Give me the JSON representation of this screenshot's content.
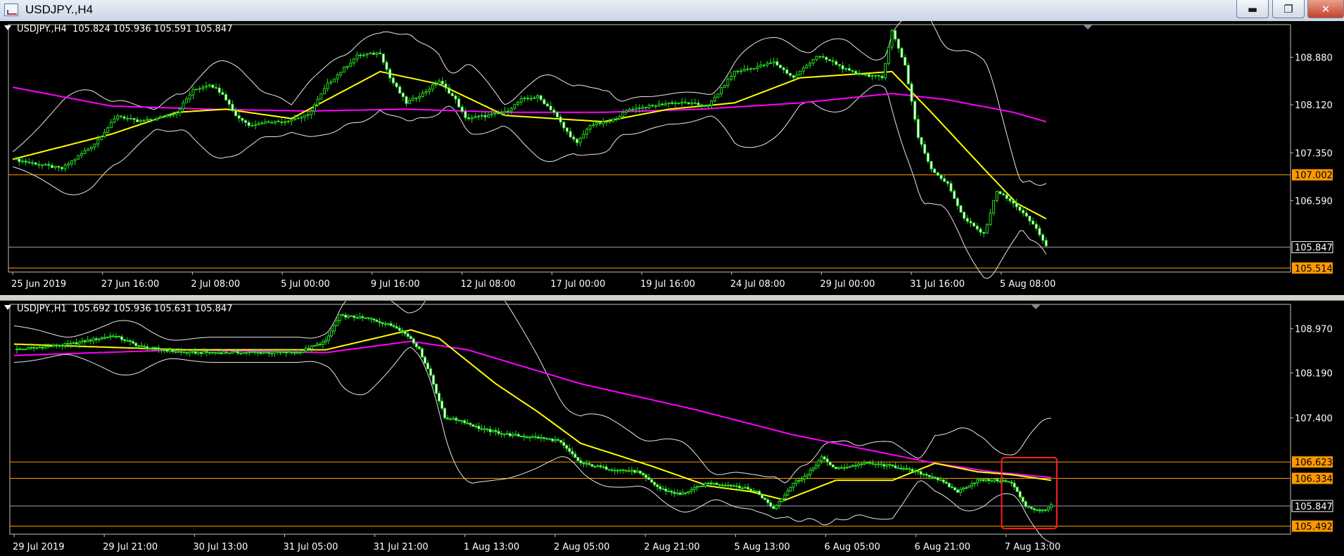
{
  "window": {
    "title": "USDJPY.,H4",
    "buttons": {
      "minimize": "▬",
      "restore": "❐",
      "close": "✕"
    }
  },
  "colors": {
    "candle": "#22dd22",
    "candle_bull_body": "#000000",
    "candle_bear_body": "#ffffff",
    "bollinger": "#e8e8e8",
    "ma_fast": "#ffff00",
    "ma_slow": "#ff00ff",
    "hline": "#ff9900",
    "current_price_line": "#9aa4b0",
    "red_box": "#ff2020"
  },
  "chart_data": [
    {
      "type": "candlestick",
      "symbol": "USDJPY.",
      "timeframe": "H4",
      "header": "USDJPY.,H4  105.824 105.936 105.591 105.847",
      "ylim": [
        105.45,
        109.4
      ],
      "y_ticks": [
        108.88,
        108.12,
        107.35,
        106.59
      ],
      "y_tick_labels": [
        "108.880",
        "108.120",
        "107.350",
        "106.590"
      ],
      "x_labels": [
        "25 Jun 2019",
        "27 Jun 16:00",
        "2 Jul 08:00",
        "5 Jul 00:00",
        "9 Jul 16:00",
        "12 Jul 08:00",
        "17 Jul 00:00",
        "19 Jul 16:00",
        "24 Jul 08:00",
        "29 Jul 00:00",
        "31 Jul 16:00",
        "5 Aug 08:00"
      ],
      "price_path": [
        [
          0,
          107.25
        ],
        [
          15,
          107.1
        ],
        [
          25,
          107.5
        ],
        [
          32,
          107.95
        ],
        [
          38,
          107.85
        ],
        [
          44,
          107.9
        ],
        [
          50,
          108.0
        ],
        [
          55,
          108.35
        ],
        [
          60,
          108.45
        ],
        [
          64,
          108.3
        ],
        [
          68,
          107.95
        ],
        [
          72,
          107.8
        ],
        [
          78,
          107.85
        ],
        [
          82,
          107.85
        ],
        [
          90,
          107.95
        ],
        [
          96,
          108.45
        ],
        [
          100,
          108.65
        ],
        [
          105,
          108.9
        ],
        [
          112,
          108.95
        ],
        [
          115,
          108.55
        ],
        [
          120,
          108.15
        ],
        [
          125,
          108.3
        ],
        [
          130,
          108.5
        ],
        [
          135,
          108.2
        ],
        [
          138,
          107.9
        ],
        [
          145,
          107.95
        ],
        [
          150,
          108.0
        ],
        [
          155,
          108.2
        ],
        [
          160,
          108.25
        ],
        [
          165,
          108.0
        ],
        [
          168,
          107.75
        ],
        [
          172,
          107.5
        ],
        [
          176,
          107.8
        ],
        [
          182,
          107.85
        ],
        [
          188,
          108.05
        ],
        [
          195,
          108.1
        ],
        [
          200,
          108.15
        ],
        [
          205,
          108.15
        ],
        [
          212,
          108.1
        ],
        [
          220,
          108.65
        ],
        [
          225,
          108.7
        ],
        [
          232,
          108.8
        ],
        [
          238,
          108.55
        ],
        [
          245,
          108.9
        ],
        [
          250,
          108.8
        ],
        [
          255,
          108.65
        ],
        [
          260,
          108.6
        ],
        [
          265,
          108.55
        ],
        [
          268,
          109.3
        ],
        [
          272,
          108.75
        ],
        [
          276,
          107.6
        ],
        [
          280,
          107.1
        ],
        [
          285,
          106.85
        ],
        [
          290,
          106.3
        ],
        [
          296,
          106.05
        ],
        [
          300,
          106.75
        ],
        [
          306,
          106.5
        ],
        [
          312,
          106.15
        ],
        [
          315,
          105.85
        ]
      ],
      "indicators": {
        "ma_fast_path": [
          [
            0,
            107.25
          ],
          [
            30,
            107.65
          ],
          [
            50,
            108.0
          ],
          [
            65,
            108.05
          ],
          [
            85,
            107.9
          ],
          [
            112,
            108.65
          ],
          [
            130,
            108.45
          ],
          [
            150,
            107.95
          ],
          [
            180,
            107.85
          ],
          [
            200,
            108.05
          ],
          [
            220,
            108.15
          ],
          [
            240,
            108.55
          ],
          [
            268,
            108.65
          ],
          [
            280,
            108.0
          ],
          [
            296,
            107.1
          ],
          [
            306,
            106.55
          ],
          [
            315,
            106.3
          ]
        ],
        "ma_slow_path": [
          [
            0,
            108.4
          ],
          [
            30,
            108.1
          ],
          [
            60,
            108.05
          ],
          [
            90,
            108.02
          ],
          [
            120,
            108.05
          ],
          [
            150,
            108.0
          ],
          [
            180,
            108.0
          ],
          [
            210,
            108.05
          ],
          [
            240,
            108.15
          ],
          [
            268,
            108.3
          ],
          [
            285,
            108.2
          ],
          [
            305,
            108.0
          ],
          [
            315,
            107.85
          ]
        ]
      },
      "horizontal_levels": [
        {
          "value": 107.002,
          "label": "107.002"
        },
        {
          "value": 105.514,
          "label": "105.514"
        }
      ],
      "current_price": {
        "value": 105.847,
        "label": "105.847"
      }
    },
    {
      "type": "candlestick",
      "symbol": "USDJPY.",
      "timeframe": "H1",
      "header": "USDJPY.,H1  105.692 105.936 105.631 105.847",
      "ylim": [
        105.35,
        109.4
      ],
      "y_ticks": [
        108.97,
        108.19,
        107.4
      ],
      "y_tick_labels": [
        "108.970",
        "108.190",
        "107.400"
      ],
      "x_labels": [
        "29 Jul 2019",
        "29 Jul 21:00",
        "30 Jul 13:00",
        "31 Jul 05:00",
        "31 Jul 21:00",
        "1 Aug 13:00",
        "2 Aug 05:00",
        "2 Aug 21:00",
        "5 Aug 13:00",
        "6 Aug 05:00",
        "6 Aug 21:00",
        "7 Aug 13:00"
      ],
      "price_path": [
        [
          0,
          108.6
        ],
        [
          20,
          108.7
        ],
        [
          35,
          108.85
        ],
        [
          45,
          108.65
        ],
        [
          60,
          108.55
        ],
        [
          80,
          108.55
        ],
        [
          100,
          108.55
        ],
        [
          110,
          108.75
        ],
        [
          115,
          109.2
        ],
        [
          125,
          109.15
        ],
        [
          135,
          109.0
        ],
        [
          140,
          108.8
        ],
        [
          143,
          108.6
        ],
        [
          147,
          108.15
        ],
        [
          152,
          107.4
        ],
        [
          158,
          107.35
        ],
        [
          165,
          107.2
        ],
        [
          175,
          107.1
        ],
        [
          185,
          107.05
        ],
        [
          192,
          107.0
        ],
        [
          200,
          106.6
        ],
        [
          210,
          106.5
        ],
        [
          220,
          106.45
        ],
        [
          228,
          106.15
        ],
        [
          235,
          106.05
        ],
        [
          245,
          106.25
        ],
        [
          255,
          106.2
        ],
        [
          262,
          106.1
        ],
        [
          268,
          105.8
        ],
        [
          275,
          106.25
        ],
        [
          280,
          106.4
        ],
        [
          285,
          106.7
        ],
        [
          290,
          106.5
        ],
        [
          300,
          106.6
        ],
        [
          310,
          106.55
        ],
        [
          318,
          106.45
        ],
        [
          325,
          106.35
        ],
        [
          333,
          106.1
        ],
        [
          340,
          106.3
        ],
        [
          348,
          106.3
        ],
        [
          352,
          106.25
        ],
        [
          357,
          105.85
        ],
        [
          362,
          105.75
        ],
        [
          366,
          105.85
        ]
      ],
      "indicators": {
        "ma_fast_path": [
          [
            0,
            108.7
          ],
          [
            60,
            108.6
          ],
          [
            110,
            108.6
          ],
          [
            140,
            108.95
          ],
          [
            150,
            108.8
          ],
          [
            170,
            108.0
          ],
          [
            185,
            107.5
          ],
          [
            200,
            106.95
          ],
          [
            225,
            106.55
          ],
          [
            245,
            106.2
          ],
          [
            260,
            106.1
          ],
          [
            272,
            105.95
          ],
          [
            290,
            106.3
          ],
          [
            310,
            106.3
          ],
          [
            325,
            106.6
          ],
          [
            340,
            106.45
          ],
          [
            352,
            106.4
          ],
          [
            366,
            106.3
          ]
        ],
        "ma_slow_path": [
          [
            0,
            108.5
          ],
          [
            60,
            108.6
          ],
          [
            110,
            108.55
          ],
          [
            140,
            108.75
          ],
          [
            160,
            108.6
          ],
          [
            200,
            108.0
          ],
          [
            240,
            107.55
          ],
          [
            275,
            107.1
          ],
          [
            300,
            106.85
          ],
          [
            325,
            106.6
          ],
          [
            345,
            106.45
          ],
          [
            366,
            106.35
          ]
        ]
      },
      "horizontal_levels": [
        {
          "value": 106.623,
          "label": "106.623"
        },
        {
          "value": 106.334,
          "label": "106.334"
        },
        {
          "value": 105.492,
          "label": "105.492"
        }
      ],
      "current_price": {
        "value": 105.847,
        "label": "105.847"
      },
      "highlight_box": {
        "x_from": 350,
        "x_to": 366,
        "y_from": 106.7,
        "y_to": 105.45
      }
    }
  ]
}
